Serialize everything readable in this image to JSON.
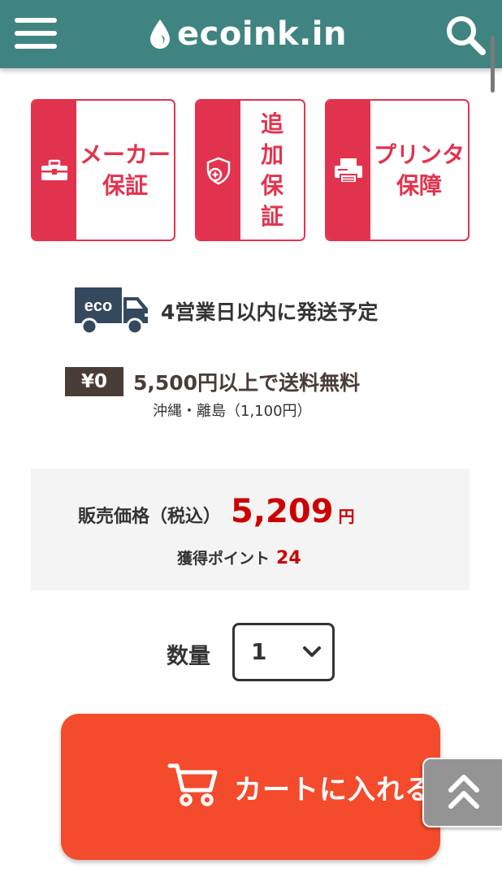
{
  "header": {
    "logo_text": "ecoink.in",
    "icons": {
      "menu": "hamburger-menu-icon",
      "logo": "ink-drop-icon",
      "search": "search-icon"
    },
    "background_color": "#3f8480"
  },
  "warranty_cards": [
    {
      "label": "メーカー保証",
      "icon": "toolbox-icon"
    },
    {
      "label": "追加保証",
      "icon": "shield-plus-icon"
    },
    {
      "label": "プリンタ保障",
      "icon": "printer-icon"
    }
  ],
  "accent_color": "#e2334e",
  "shipping": {
    "truck_label": "eco",
    "text": "4営業日以内に発送予定"
  },
  "free_shipping": {
    "badge": "¥0",
    "text": "5,500円以上で送料無料",
    "note": "沖縄・離島（1,100円）"
  },
  "price": {
    "label": "販売価格（税込）",
    "value": "5,209",
    "unit": "円",
    "points_label": "獲得ポイント",
    "points_value": "24",
    "color": "#cc0000"
  },
  "quantity": {
    "label": "数量",
    "selected": "1"
  },
  "cart": {
    "label": "カートに入れる",
    "color": "#f44b2c",
    "icon": "cart-icon"
  },
  "back_to_top_icon": "double-chevron-up-icon"
}
